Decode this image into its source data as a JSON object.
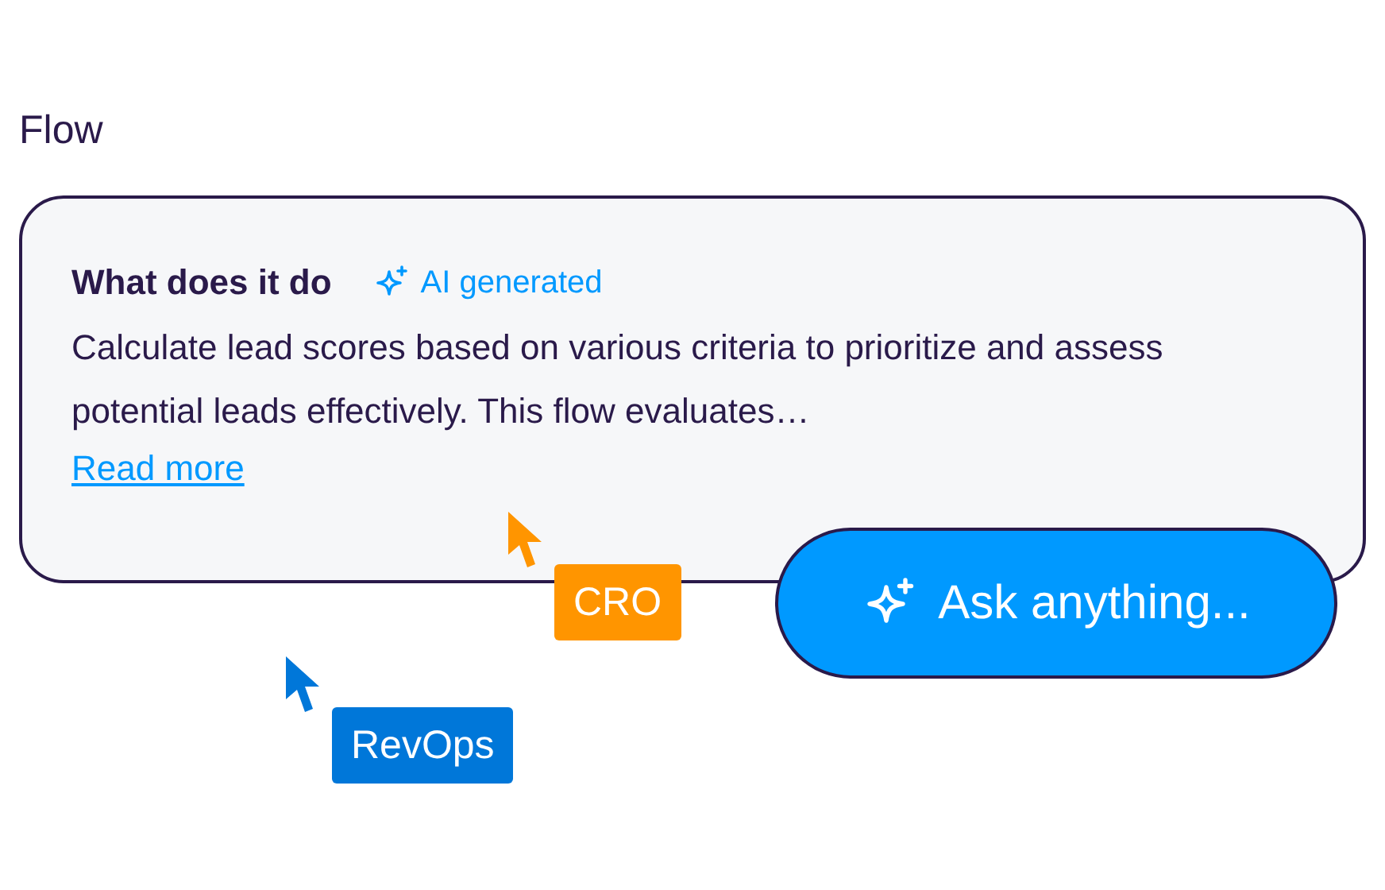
{
  "section_label": "Flow",
  "card": {
    "title": "What does it do",
    "badge": "AI generated",
    "description": "Calculate lead scores based on various criteria to prioritize and assess potential leads effectively. This flow evaluates…",
    "link": "Read more"
  },
  "ask_button": {
    "label": "Ask anything..."
  },
  "cursors": [
    {
      "label": "CRO",
      "color": "#ff9500"
    },
    {
      "label": "RevOps",
      "color": "#0077d9"
    }
  ]
}
